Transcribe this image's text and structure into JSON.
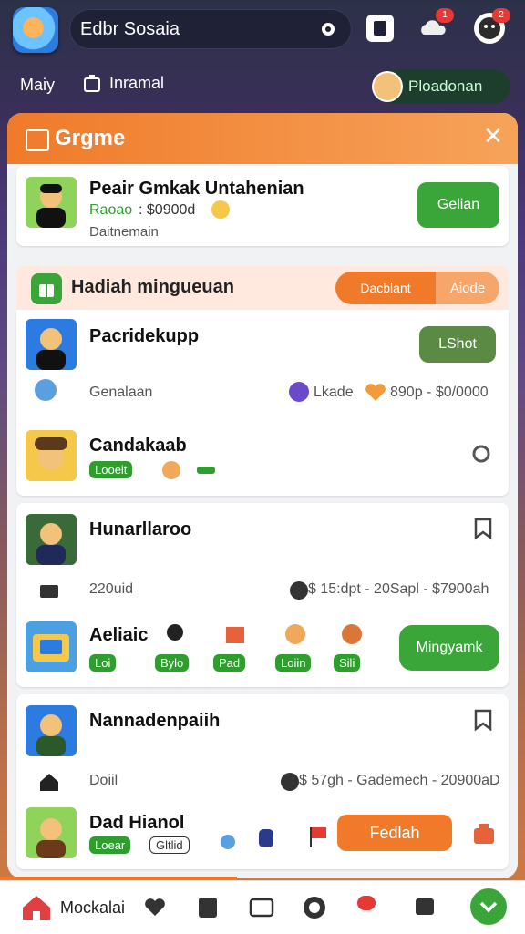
{
  "top": {
    "search_text": "Edbr Sosaia",
    "badges": [
      "1",
      "2"
    ]
  },
  "subnav": {
    "item1": "Maiy",
    "item2": "Inramal",
    "right_label": "Ploadonan"
  },
  "sheet": {
    "title": "Grgme"
  },
  "card1": {
    "name": "Peair Gmkak Untahenian",
    "detail": "Raoao",
    "detail_amount": ": $0900d",
    "sub": "Daitnemain",
    "button": "Gelian"
  },
  "section": {
    "title": "Hadiah mingueuan",
    "pill_left": "Dacblant",
    "pill_right": "Aiode"
  },
  "card2": {
    "row1_name": "Pacridekupp",
    "row1_button": "LShot",
    "row2_label": "Genalaan",
    "row2_middle": "Lkade",
    "row2_right": "890p - $0/0000",
    "row3_name": "Candakaab",
    "row3_pill": "Looeit"
  },
  "card3": {
    "name": "Hunarllaroo",
    "row2_label": "220uid",
    "row2_right": "$ 15:dpt - 20Sapl - $7900ah",
    "row3_name": "Aeliaic",
    "pills": [
      "Loi",
      "Bylo",
      "Pad",
      "Loiin",
      "Sili"
    ],
    "button": "Mingyamk"
  },
  "card4": {
    "name": "Nannadenpaiih",
    "row2_label": "Doiil",
    "row2_right": "$ 57gh - Gademech - 20900aD",
    "row3_name": "Dad Hianol",
    "row3_pill": "Loear",
    "row3_pill2": "Gltlid",
    "button": "Fedlah"
  },
  "nav": {
    "label": "Mockalai"
  }
}
